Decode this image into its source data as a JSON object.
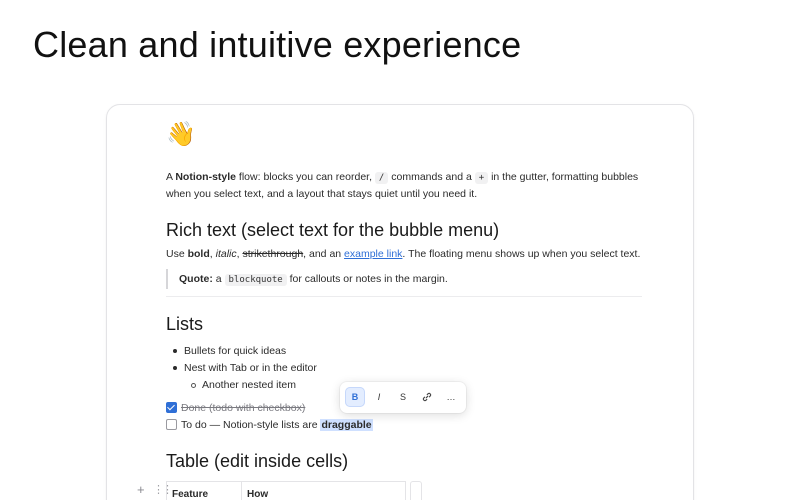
{
  "hero": {
    "title": "Clean and intuitive experience"
  },
  "doc": {
    "emoji": "👋",
    "intro": {
      "prefix": "A ",
      "bold": "Notion-style",
      "part1": " flow: blocks you can reorder, ",
      "code1": "/",
      "part2": " commands and a ",
      "code2": "+",
      "part3": " in the gutter, formatting bubbles when you select text, and a layout that stays quiet until you need it."
    },
    "rich": {
      "heading": "Rich text (select text for the bubble menu)",
      "use": "Use ",
      "bold": "bold",
      "sep1": ", ",
      "italic": "italic",
      "sep2": ", ",
      "strike": "strikethrough",
      "sep3": ", and an ",
      "link": "example link",
      "tail": ". The floating menu shows up when you select text."
    },
    "quote": {
      "label": "Quote:",
      "pre": " a ",
      "code": "blockquote",
      "post": " for callouts or notes in the margin."
    },
    "lists": {
      "heading": "Lists",
      "bullets": [
        "Bullets for quick ideas",
        "Nest with Tab or in the editor"
      ],
      "nested": "Another nested item"
    },
    "todos": [
      {
        "text": "Done (todo with checkbox)",
        "checked": true
      },
      {
        "text_prefix": "To do — Notion-style lists are ",
        "highlight": "draggable",
        "checked": false
      }
    ],
    "bubble_menu": {
      "bold": "B",
      "italic": "I",
      "strike": "S",
      "more": "…"
    },
    "table": {
      "heading": "Table (edit inside cells)",
      "gutter_plus": "+",
      "gutter_grip": "⋮⋮",
      "columns": [
        "Feature",
        "How"
      ]
    }
  }
}
